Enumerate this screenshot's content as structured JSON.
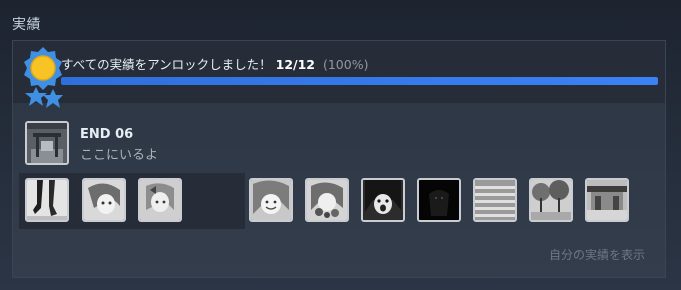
{
  "section_title": "実績",
  "progress": {
    "message": "すべての実績をアンロックしました！",
    "count_text": "12/12",
    "percent_text": "(100%)",
    "fraction": 1.0,
    "fill_color": "#3b82f6"
  },
  "featured_achievement": {
    "title": "END 06",
    "description": "ここにいるよ",
    "icon": "shrine-gate-image"
  },
  "achievement_icons": [
    {
      "icon": "legs-sketch-image"
    },
    {
      "icon": "girl-portrait-image"
    },
    {
      "icon": "girl-with-ribbon-image"
    },
    {
      "icon": "smiling-girl-image"
    },
    {
      "icon": "girl-with-flowers-image"
    },
    {
      "icon": "crying-girl-image"
    },
    {
      "icon": "dark-silhouette-image"
    },
    {
      "icon": "staircase-image"
    },
    {
      "icon": "park-trees-image"
    },
    {
      "icon": "shrine-building-image"
    }
  ],
  "view_link": "自分の実績を表示",
  "colors": {
    "background": "#1d2430",
    "panel": "#2f3947",
    "accent": "#3b82f6",
    "medal_gold": "#f7c325",
    "medal_blue": "#3f8fe4"
  }
}
